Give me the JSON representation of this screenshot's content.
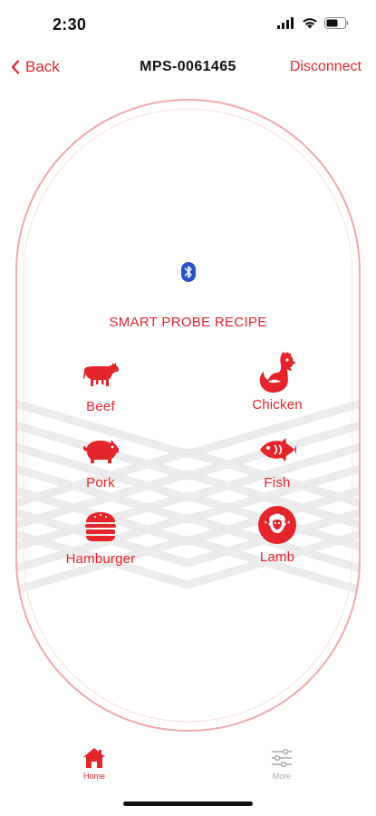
{
  "status_bar": {
    "time": "2:30"
  },
  "nav": {
    "back_label": "Back",
    "title": "MPS-0061465",
    "disconnect_label": "Disconnect"
  },
  "main": {
    "section_title": "SMART PROBE RECIPE",
    "recipes": [
      {
        "label": "Beef",
        "icon": "cow-icon"
      },
      {
        "label": "Chicken",
        "icon": "rooster-icon"
      },
      {
        "label": "Pork",
        "icon": "pig-icon"
      },
      {
        "label": "Fish",
        "icon": "fish-icon"
      },
      {
        "label": "Hamburger",
        "icon": "hamburger-icon"
      },
      {
        "label": "Lamb",
        "icon": "sheep-icon"
      }
    ]
  },
  "tab_bar": {
    "items": [
      {
        "label": "Home",
        "icon": "home-icon",
        "active": true
      },
      {
        "label": "More",
        "icon": "sliders-icon",
        "active": false
      }
    ]
  },
  "colors": {
    "accent": "#e4252b",
    "bluetooth": "#2b50c8",
    "capsule_stroke": "#f2a9ab",
    "chevron_pattern": "#ececec",
    "inactive": "#a9a9a9"
  }
}
